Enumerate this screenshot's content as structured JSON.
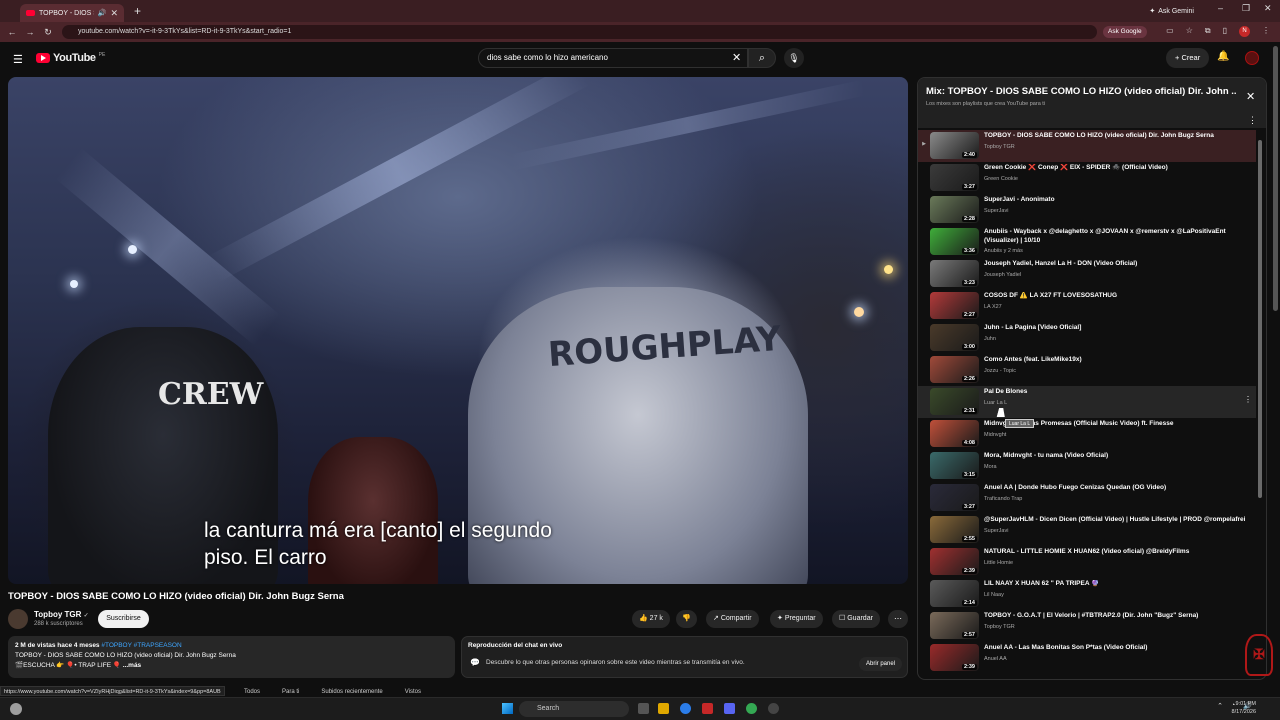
{
  "browser": {
    "tab_title": "TOPBOY - DIOS SABE CO",
    "tab_close": "✕",
    "new_tab": "+",
    "ask_gemini": "Ask Gemini",
    "url": "youtube.com/watch?v=-it-9-3TkYs&list=RD-it-9-3TkYs&start_radio=1",
    "ask_google": "Ask Google",
    "profile_initial": "N",
    "window_controls": [
      "–",
      "❐",
      "✕"
    ]
  },
  "youtube": {
    "logo_text": "YouTube",
    "logo_region": "PE",
    "search_value": "dios sabe como lo hizo americano",
    "create_label": "+ Crear"
  },
  "video": {
    "caption_line1": "la canturra má era [canto] el segundo",
    "caption_line2": "piso. El carro",
    "title": "TOPBOY - DIOS SABE COMO LO HIZO (video oficial) Dir. John Bugz Serna",
    "channel": "Topboy TGR",
    "verified": "✓",
    "subscribers": "288 k suscriptores",
    "subscribe_label": "Suscribirse",
    "likes": "27 k",
    "share_label": "Compartir",
    "ask_label": "Preguntar",
    "save_label": "Guardar",
    "description": {
      "stats": "2 M de vistas  hace 4 meses ",
      "tags": "#TOPBOY #TRAPSEASON",
      "line2": "TOPBOY - DIOS SABE COMO LO HIZO (video oficial) Dir. John Bugz Serna",
      "line3": "🎬ESCUCHA 👉 🎈• TRAP LIFE 🎈",
      "more": "...más"
    },
    "chat": {
      "title": "Reproducción del chat en vivo",
      "desc": "Descubre lo que otras personas opinaron sobre este video mientras se transmitía en vivo.",
      "open_panel": "Abrir panel"
    }
  },
  "status_url": "https://www.youtube.com/watch?v=VZIyRHjDiqg&list=RD-it-9-3TkYs&index=9&pp=8AUB",
  "bottom_chips": [
    "Todos",
    "Para ti",
    "Subidos recientemente",
    "Vistos"
  ],
  "playlist": {
    "title": "Mix: TOPBOY - DIOS SABE COMO LO HIZO (video oficial) Dir. John ...",
    "subtitle": "Los mixes son playlists que crea YouTube para ti",
    "items": [
      {
        "title": "TOPBOY - DIOS SABE COMO LO HIZO (video oficial) Dir. John Bugz Serna",
        "channel": "Topboy TGR",
        "duration": "2:40",
        "color": "#8a8a8a",
        "index": "▶"
      },
      {
        "title": "Green Cookie ❌ Conep ❌ EIX - SPIDER 🕷️ (Official Video)",
        "channel": "Green Cookie",
        "duration": "3:27",
        "color": "#3b3b3b",
        "index": ""
      },
      {
        "title": "SuperJavi - Anonimato",
        "channel": "SuperJavi",
        "duration": "2:28",
        "color": "#6a7a5a",
        "index": ""
      },
      {
        "title": "Anubiis - Wayback x @delaghetto x @JOVAAN x @remerstv x @LaPositivaEnt (Visualizer) | 10/10",
        "channel": "Anubiis y 2 más",
        "duration": "3:36",
        "color": "#3fae3a",
        "index": ""
      },
      {
        "title": "Jouseph Yadiel, Hanzel La H - DON (Video Oficial)",
        "channel": "Jouseph Yadiel",
        "duration": "3:23",
        "color": "#7a7a7a",
        "index": ""
      },
      {
        "title": "COSOS DF ⚠️ LA X27 FT LOVESOSATHUG",
        "channel": "LA X27",
        "duration": "2:27",
        "color": "#b33a3a",
        "index": ""
      },
      {
        "title": "Juhn - La Pagina [Video Oficial]",
        "channel": "Juhn",
        "duration": "3:00",
        "color": "#4a3a2a",
        "index": ""
      },
      {
        "title": "Como Antes (feat. LikeMike19x)",
        "channel": "Jozzu - Topic",
        "duration": "2:26",
        "color": "#a04a3a",
        "index": ""
      },
      {
        "title": "Pal De Blones",
        "channel": "Luar La L",
        "duration": "2:31",
        "color": "#3a4a2a",
        "index": ""
      },
      {
        "title": "Midnvght - Falsas Promesas (Official Music Video) ft. Finesse",
        "channel": "Midnvght",
        "duration": "4:08",
        "color": "#c0503a",
        "index": ""
      },
      {
        "title": "Mora, Midnvght - tu nama (Video Oficial)",
        "channel": "Mora",
        "duration": "3:15",
        "color": "#3a6a6a",
        "index": ""
      },
      {
        "title": "Anuel AA | Donde Hubo Fuego Cenizas Quedan (OG Video)",
        "channel": "Traficando Trap",
        "duration": "3:27",
        "color": "#2a2a3a",
        "index": ""
      },
      {
        "title": "@SuperJavHLM - Dicen Dicen (Official Video) | Hustle Lifestyle | PROD @rompelafrei",
        "channel": "SuperJavi",
        "duration": "2:55",
        "color": "#8a6a3a",
        "index": ""
      },
      {
        "title": "NATURAL - LITTLE HOMIE X HUAN62 (Video oficial) @BreidyFilms",
        "channel": "Little Homie",
        "duration": "2:39",
        "color": "#a03030",
        "index": ""
      },
      {
        "title": "LIL NAAY X HUAN 62 \" PA TRIPEA 🔮",
        "channel": "Lil Naay",
        "duration": "2:14",
        "color": "#5a5a5a",
        "index": ""
      },
      {
        "title": "TOPBOY - G.O.A.T | El Velorio | #TBTRAP2.0 (Dir. John \"Bugz\" Serna)",
        "channel": "Topboy TGR",
        "duration": "2:57",
        "color": "#7a6a5a",
        "index": ""
      },
      {
        "title": "Anuel AA - Las Mas Bonitas Son P*tas (Video Oficial)",
        "channel": "Anuel AA",
        "duration": "2:39",
        "color": "#9a2a2a",
        "index": ""
      }
    ],
    "tooltip": "Luar La L"
  },
  "taskbar": {
    "search_label": "Search",
    "time": "9:01 PM",
    "date": "8/17/2026"
  }
}
